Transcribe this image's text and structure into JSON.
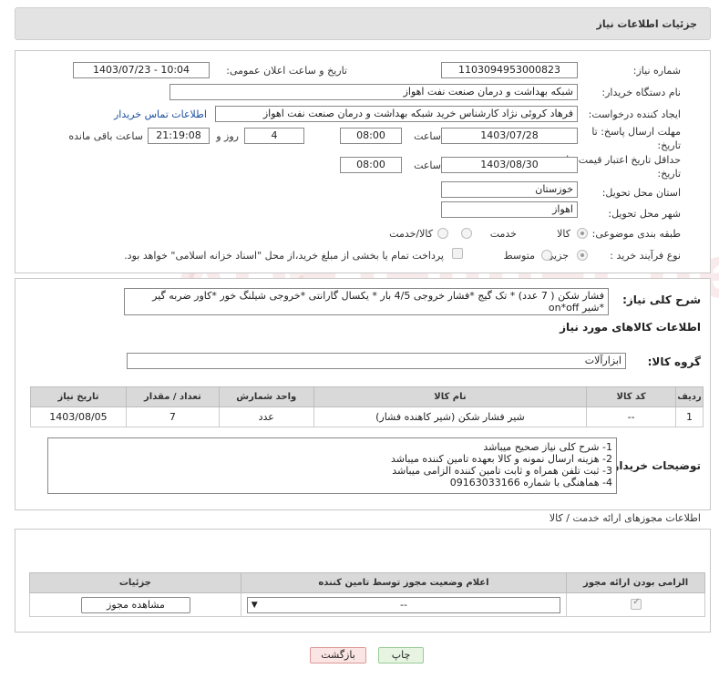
{
  "header": {
    "title": "جزئیات اطلاعات نیاز"
  },
  "form": {
    "need_number_label": "شماره نیاز:",
    "need_number": "1103094953000823",
    "announce_label": "تاریخ و ساعت اعلان عمومی:",
    "announce_value": "1403/07/23 - 10:04",
    "buyer_label": "نام دستگاه خریدار:",
    "buyer_value": "شبکه بهداشت و درمان صنعت نفت اهواز",
    "creator_label": "ایجاد کننده درخواست:",
    "creator_value": "فرهاد کروئی نژاد کارشناس خرید شبکه بهداشت و درمان صنعت نفت اهواز",
    "contact_link": "اطلاعات تماس خریدار",
    "deadline_label_1": "مهلت ارسال پاسخ: تا",
    "deadline_label_2": "تاریخ:",
    "deadline_date": "1403/07/28",
    "time_label": "ساعت",
    "deadline_time": "08:00",
    "days_value": "4",
    "days_label": "روز و",
    "remaining_value": "21:19:08",
    "remaining_label": "ساعت باقی مانده",
    "validity_label_1": "حداقل تاریخ اعتبار قیمت: تا",
    "validity_label_2": "تاریخ:",
    "validity_date": "1403/08/30",
    "validity_time": "08:00",
    "province_label": "استان محل تحویل:",
    "province_value": "خوزستان",
    "city_label": "شهر محل تحویل:",
    "city_value": "اهواز",
    "category_label": "طبقه بندی موضوعی:",
    "category_options": [
      "کالا",
      "خدمت",
      "کالا/خدمت"
    ],
    "process_label": "نوع فرآیند خرید :",
    "process_options": [
      "جزیی",
      "متوسط"
    ],
    "payment_note": "پرداخت تمام یا بخشی از مبلغ خرید،از محل \"اسناد خزانه اسلامی\" خواهد بود."
  },
  "description": {
    "label": "شرح کلی نیاز:",
    "text": "فشار شکن ( 7 عدد) * تک گیج *فشار خروجی 4/5 بار * یکسال گارانتی *خروجی شیلنگ خور *کاور ضربه گیر *شیر on*off"
  },
  "goods": {
    "section_title": "اطلاعات کالاهای مورد نیاز",
    "group_label": "گروه کالا:",
    "group_value": "ابزارآلات",
    "columns": [
      "ردیف",
      "کد کالا",
      "نام کالا",
      "واحد شمارش",
      "تعداد / مقدار",
      "تاریخ نیاز"
    ],
    "rows": [
      {
        "row": "1",
        "code": "--",
        "name": "شیر فشار شکن (شیر کاهنده فشار)",
        "unit": "عدد",
        "qty": "7",
        "date": "1403/08/05"
      }
    ]
  },
  "buyer_notes": {
    "label": "توضیحات خریدار:",
    "lines": [
      "1- شرح کلی نیاز صحیح میباشد",
      "2- هزینه ارسال نمونه و کالا بعهده تامین کننده میباشد",
      "3- ثبت تلفن همراه و ثابت تامین کننده الزامی میباشد",
      "4- هماهنگی با شماره 09163033166"
    ]
  },
  "permits": {
    "section_title": "اطلاعات مجوزهای ارائه خدمت / کالا",
    "columns": [
      "الزامی بودن ارائه مجوز",
      "اعلام وضعیت مجوز توسط تامین کننده",
      "جزئیات"
    ],
    "select_value": "--",
    "view_button": "مشاهده مجوز"
  },
  "footer": {
    "print_button": "چاپ",
    "back_button": "بازگشت"
  }
}
